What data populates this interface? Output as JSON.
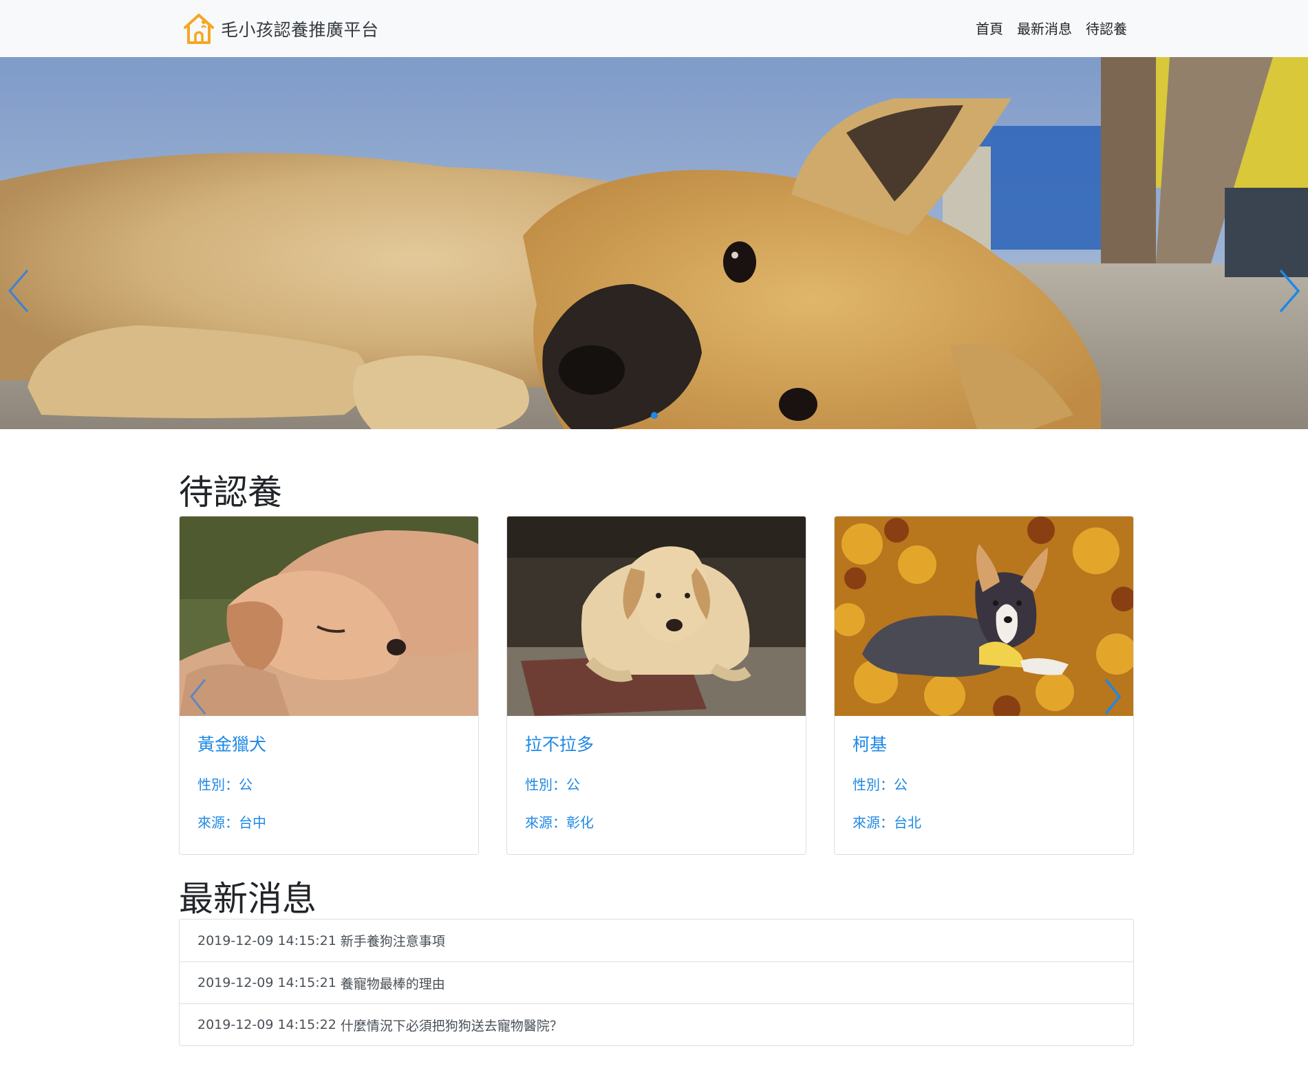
{
  "navbar": {
    "brand": "毛小孩認養推廣平台",
    "links": [
      "首頁",
      "最新消息",
      "待認養"
    ]
  },
  "hero": {
    "icon_prev": "chevron-left-icon",
    "icon_next": "chevron-right-icon",
    "active_slide": 1,
    "slide_count": 1
  },
  "adopt": {
    "title": "待認養",
    "cards": [
      {
        "name": "黃金獵犬",
        "gender": "性別：公",
        "source": "來源：台中"
      },
      {
        "name": "拉不拉多",
        "gender": "性別：公",
        "source": "來源：彰化"
      },
      {
        "name": "柯基",
        "gender": "性別：公",
        "source": "來源：台北"
      }
    ]
  },
  "news": {
    "title": "最新消息",
    "items": [
      {
        "date": "2019-12-09 14:15:21",
        "title": "新手養狗注意事項"
      },
      {
        "date": "2019-12-09 14:15:21",
        "title": "養寵物最棒的理由"
      },
      {
        "date": "2019-12-09 14:15:22",
        "title": "什麼情況下必須把狗狗送去寵物醫院？"
      }
    ]
  },
  "colors": {
    "accent": "#1e88e5",
    "navbar_bg": "#f8f9fa",
    "logo": "#f5a623"
  }
}
